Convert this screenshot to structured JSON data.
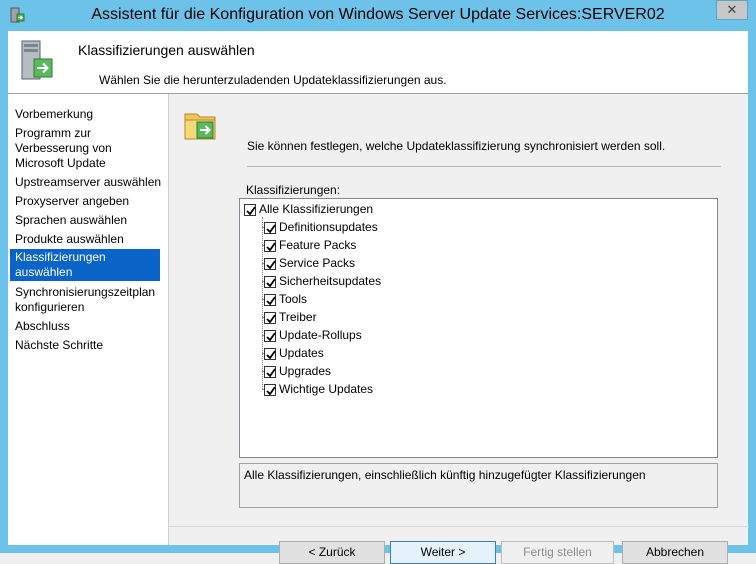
{
  "window": {
    "title": "Assistent für die Konfiguration von Windows Server Update Services:SERVER02",
    "close_glyph": "✕"
  },
  "header": {
    "title": "Klassifizierungen auswählen",
    "subtitle": "Wählen Sie die herunterzuladenden Updateklassifizierungen aus."
  },
  "nav": {
    "items": [
      {
        "label": "Vorbemerkung",
        "selected": false
      },
      {
        "label": "Programm zur Verbesserung von Microsoft Update",
        "selected": false
      },
      {
        "label": "Upstreamserver auswählen",
        "selected": false
      },
      {
        "label": "Proxyserver angeben",
        "selected": false
      },
      {
        "label": "Sprachen auswählen",
        "selected": false
      },
      {
        "label": "Produkte auswählen",
        "selected": false
      },
      {
        "label": "Klassifizierungen auswählen",
        "selected": true
      },
      {
        "label": "Synchronisierungszeitplan konfigurieren",
        "selected": false
      },
      {
        "label": "Abschluss",
        "selected": false
      },
      {
        "label": "Nächste Schritte",
        "selected": false
      }
    ]
  },
  "main": {
    "intro": "Sie können festlegen, welche Updateklassifizierung synchronisiert werden soll.",
    "classifications_label": "Klassifizierungen:",
    "root": {
      "label": "Alle Klassifizierungen",
      "checked": true
    },
    "children": [
      {
        "label": "Definitionsupdates",
        "checked": true
      },
      {
        "label": "Feature Packs",
        "checked": true
      },
      {
        "label": "Service Packs",
        "checked": true
      },
      {
        "label": "Sicherheitsupdates",
        "checked": true
      },
      {
        "label": "Tools",
        "checked": true
      },
      {
        "label": "Treiber",
        "checked": true
      },
      {
        "label": "Update-Rollups",
        "checked": true
      },
      {
        "label": "Updates",
        "checked": true
      },
      {
        "label": "Upgrades",
        "checked": true
      },
      {
        "label": "Wichtige Updates",
        "checked": true
      }
    ],
    "description": "Alle Klassifizierungen, einschließlich künftig hinzugefügter Klassifizierungen"
  },
  "buttons": {
    "back": "< Zurück",
    "next": "Weiter >",
    "finish": "Fertig stellen",
    "cancel": "Abbrechen"
  },
  "colors": {
    "titlebar": "#6dc2e9",
    "selection": "#0a64c8"
  }
}
